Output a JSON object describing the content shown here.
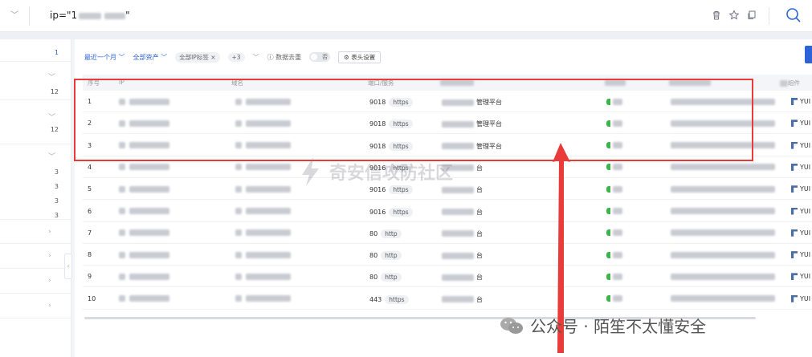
{
  "topbar": {
    "collapse_icon": "chevron-down-icon",
    "query_prefix": "ip=\"1",
    "query_suffix": "\"",
    "icons": [
      "trash-icon",
      "star-icon",
      "copy-icon",
      "search-icon"
    ]
  },
  "sidebar": {
    "counts": [
      "1",
      "12",
      "12",
      "3",
      "3",
      "3",
      "3"
    ]
  },
  "filters": {
    "time": "最近一个月",
    "assets": "全部资产",
    "tag": "全部IP标签",
    "tag_close": "×",
    "more": "+3",
    "dedupe": "数据去重",
    "toggle": "否",
    "settings": "表头设置"
  },
  "table": {
    "headers": [
      "序号",
      "IP",
      "域名",
      "端口/服务",
      "",
      "",
      "",
      "组件"
    ],
    "rows": [
      {
        "no": "1",
        "port": "9018",
        "proto": "https",
        "product": "管理平台"
      },
      {
        "no": "2",
        "port": "9018",
        "proto": "https",
        "product": "管理平台"
      },
      {
        "no": "3",
        "port": "9018",
        "proto": "https",
        "product": "管理平台"
      },
      {
        "no": "4",
        "port": "9016",
        "proto": "https",
        "product": "台"
      },
      {
        "no": "5",
        "port": "9016",
        "proto": "https",
        "product": "台"
      },
      {
        "no": "6",
        "port": "9016",
        "proto": "https",
        "product": "台"
      },
      {
        "no": "7",
        "port": "80",
        "proto": "http",
        "product": "台"
      },
      {
        "no": "8",
        "port": "80",
        "proto": "http",
        "product": "台"
      },
      {
        "no": "9",
        "port": "80",
        "proto": "http",
        "product": "台"
      },
      {
        "no": "10",
        "port": "443",
        "proto": "https",
        "product": "台"
      }
    ],
    "component_text": "YUI"
  },
  "watermarks": {
    "center": "奇安信攻防社区",
    "bottom": "公众号 · 陌笙不太懂安全"
  },
  "colors": {
    "accent": "#2d63d8",
    "highlight_border": "#ea3b3b",
    "status_green": "#39b54a"
  }
}
